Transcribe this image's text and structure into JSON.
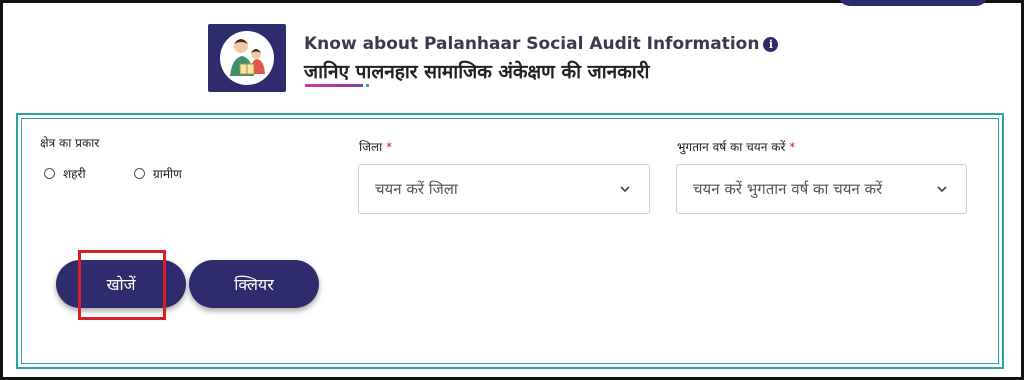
{
  "header": {
    "title_en": "Know about Palanhaar Social Audit Information",
    "title_hi": "जानिए पालनहार सामाजिक अंकेक्षण की जानकारी",
    "info_icon_glyph": "i"
  },
  "form": {
    "area_type": {
      "label": "क्षेत्र का प्रकार",
      "options": [
        "शहरी",
        "ग्रामीण"
      ]
    },
    "district": {
      "label": "जिला",
      "required_mark": "*",
      "placeholder": "चयन करें जिला"
    },
    "payment_year": {
      "label": "भुगतान वर्ष का चयन करें",
      "required_mark": "*",
      "placeholder": "चयन करें भुगतान वर्ष का चयन करें"
    },
    "search_button": "खोजें",
    "clear_button": "क्लियर"
  },
  "colors": {
    "brand": "#2f2c6e",
    "card_border": "#2aa6a0",
    "highlight": "#d61f2b",
    "required": "#d0201f"
  },
  "icons": {
    "logo": "parent-with-child-logo",
    "info": "info-icon",
    "dropdown": "chevron-down-icon"
  }
}
